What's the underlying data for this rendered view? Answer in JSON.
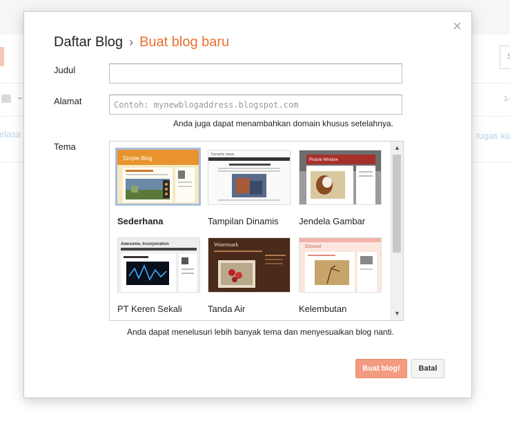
{
  "background": {
    "left_text": "jelasa",
    "right_text": "tugas ku",
    "right_box_text": "S",
    "right_number": "1-"
  },
  "dialog": {
    "breadcrumb_root": "Daftar Blog",
    "breadcrumb_separator": "›",
    "breadcrumb_current": "Buat blog baru",
    "close_glyph": "×",
    "title_label": "Judul",
    "title_value": "",
    "address_label": "Alamat",
    "address_placeholder": "Contoh: mynewblogaddress.blogspot.com",
    "address_hint": "Anda juga dapat menambahkan domain khusus setelahnya.",
    "theme_label": "Tema",
    "themes": [
      {
        "name": "Sederhana",
        "selected": true,
        "thumb_text": "Simple Blog"
      },
      {
        "name": "Tampilan Dinamis",
        "selected": false,
        "thumb_text": "Dynamic views"
      },
      {
        "name": "Jendela Gambar",
        "selected": false,
        "thumb_text": "Picture Window"
      },
      {
        "name": "PT Keren Sekali",
        "selected": false,
        "thumb_text": "Awesome, Incorporation"
      },
      {
        "name": "Tanda Air",
        "selected": false,
        "thumb_text": "Watermark"
      },
      {
        "name": "Kelembutan",
        "selected": false,
        "thumb_text": "Ethereal"
      }
    ],
    "theme_hint": "Anda dapat menelusuri lebih banyak tema dan menyesuaikan blog nanti.",
    "create_button": "Buat blog!",
    "cancel_button": "Batal"
  },
  "colors": {
    "accent_orange": "#e8712d",
    "create_button_bg": "#f39b80",
    "selected_border": "#a9bcdc"
  }
}
